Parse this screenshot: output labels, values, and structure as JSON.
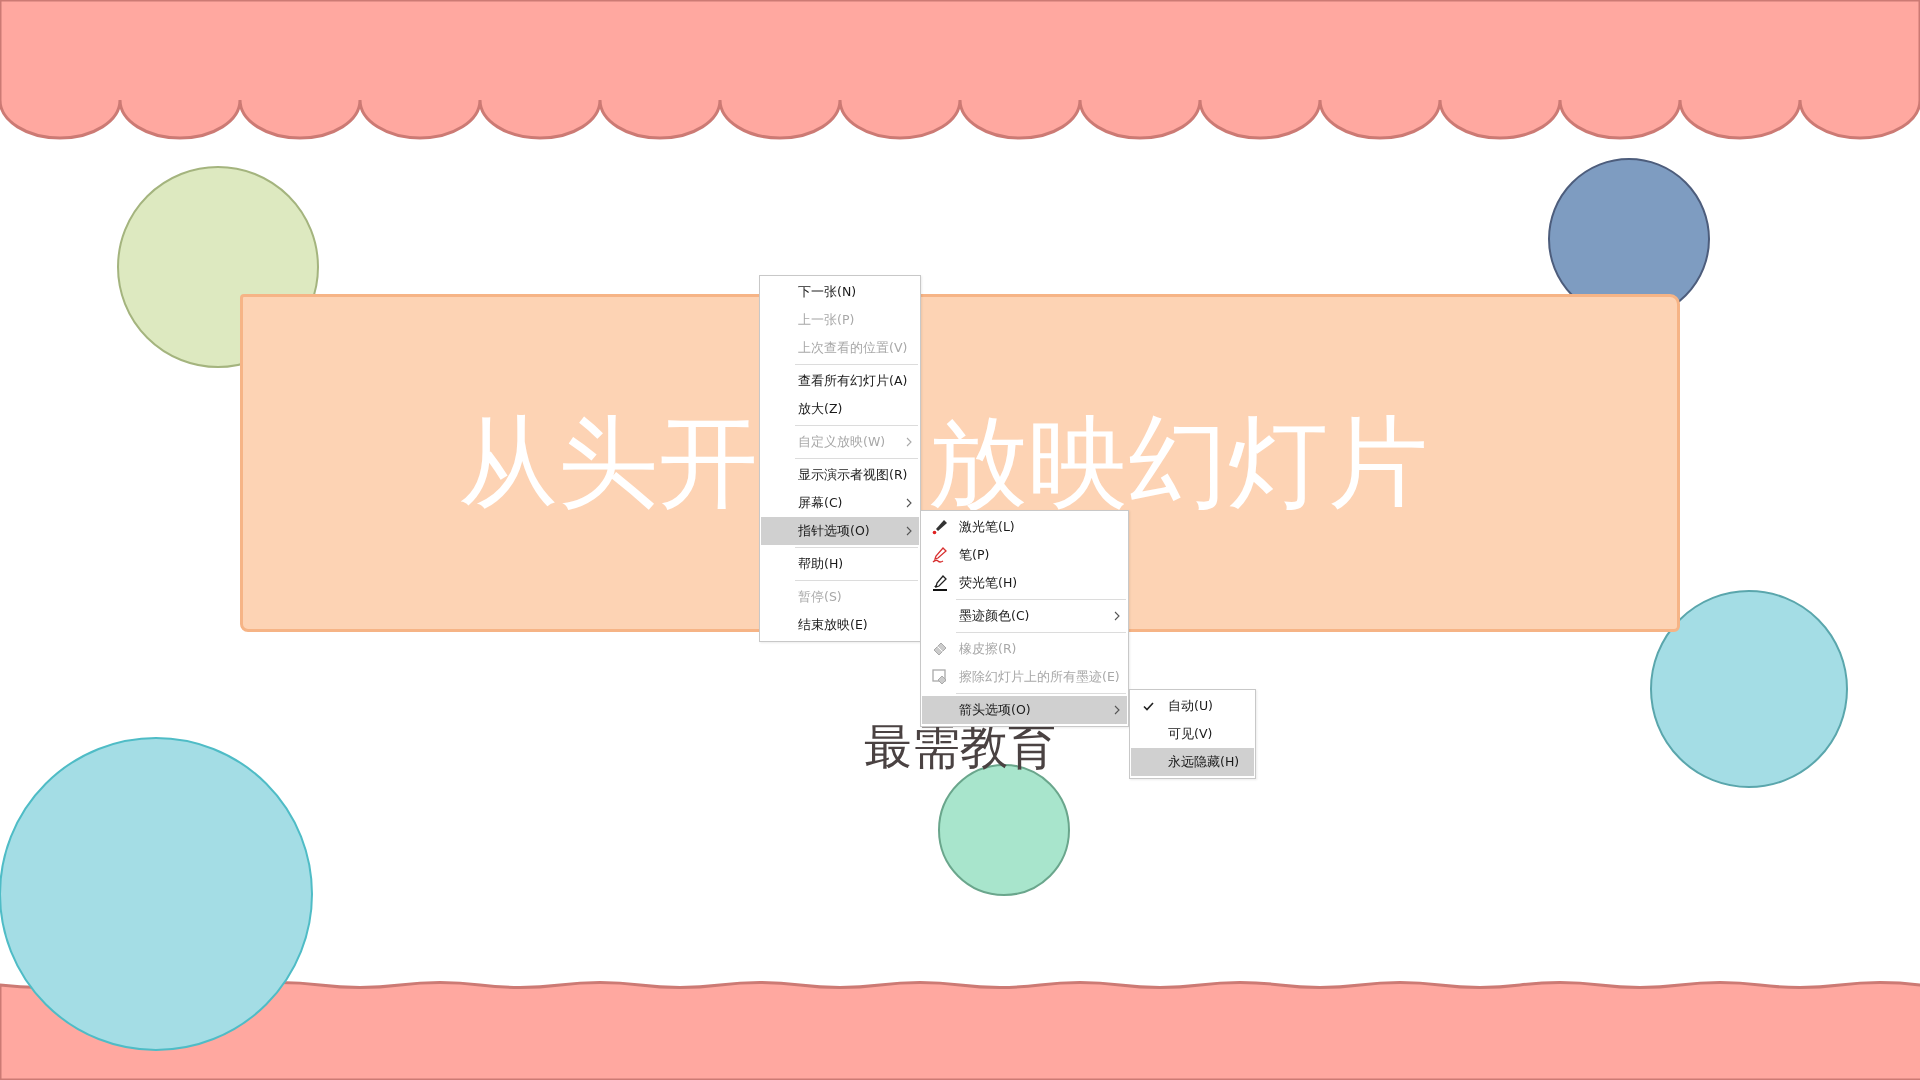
{
  "slide": {
    "title_fragments": [
      "从头开",
      "放映幻灯片"
    ],
    "subtitle": "最需教育"
  },
  "context_menu": [
    {
      "kind": "item",
      "label": "下一张(N)",
      "disabled": false,
      "selected": false,
      "submenu": false
    },
    {
      "kind": "item",
      "label": "上一张(P)",
      "disabled": true,
      "selected": false,
      "submenu": false
    },
    {
      "kind": "item",
      "label": "上次查看的位置(V)",
      "disabled": true,
      "selected": false,
      "submenu": false
    },
    {
      "kind": "separator"
    },
    {
      "kind": "item",
      "label": "查看所有幻灯片(A)",
      "disabled": false,
      "selected": false,
      "submenu": false
    },
    {
      "kind": "item",
      "label": "放大(Z)",
      "disabled": false,
      "selected": false,
      "submenu": false
    },
    {
      "kind": "separator"
    },
    {
      "kind": "item",
      "label": "自定义放映(W)",
      "disabled": true,
      "selected": false,
      "submenu": true
    },
    {
      "kind": "separator"
    },
    {
      "kind": "item",
      "label": "显示演示者视图(R)",
      "disabled": false,
      "selected": false,
      "submenu": false
    },
    {
      "kind": "item",
      "label": "屏幕(C)",
      "disabled": false,
      "selected": false,
      "submenu": true
    },
    {
      "kind": "item",
      "label": "指针选项(O)",
      "disabled": false,
      "selected": true,
      "submenu": true
    },
    {
      "kind": "separator"
    },
    {
      "kind": "item",
      "label": "帮助(H)",
      "disabled": false,
      "selected": false,
      "submenu": false
    },
    {
      "kind": "separator"
    },
    {
      "kind": "item",
      "label": "暂停(S)",
      "disabled": true,
      "selected": false,
      "submenu": false
    },
    {
      "kind": "item",
      "label": "结束放映(E)",
      "disabled": false,
      "selected": false,
      "submenu": false
    }
  ],
  "pointer_submenu": [
    {
      "kind": "item",
      "label": "激光笔(L)",
      "disabled": false,
      "selected": false,
      "submenu": false
    },
    {
      "kind": "item",
      "label": "笔(P)",
      "disabled": false,
      "selected": false,
      "submenu": false
    },
    {
      "kind": "item",
      "label": "荧光笔(H)",
      "disabled": false,
      "selected": false,
      "submenu": false
    },
    {
      "kind": "separator"
    },
    {
      "kind": "item",
      "label": "墨迹颜色(C)",
      "disabled": false,
      "selected": false,
      "submenu": true
    },
    {
      "kind": "separator"
    },
    {
      "kind": "item",
      "label": "橡皮擦(R)",
      "disabled": true,
      "selected": false,
      "submenu": false
    },
    {
      "kind": "item",
      "label": "擦除幻灯片上的所有墨迹(E)",
      "disabled": true,
      "selected": false,
      "submenu": false
    },
    {
      "kind": "separator"
    },
    {
      "kind": "item",
      "label": "箭头选项(O)",
      "disabled": false,
      "selected": true,
      "submenu": true
    }
  ],
  "arrow_submenu": [
    {
      "kind": "item",
      "label": "自动(U)",
      "disabled": false,
      "selected": false,
      "submenu": false,
      "checked": true
    },
    {
      "kind": "item",
      "label": "可见(V)",
      "disabled": false,
      "selected": false,
      "submenu": false,
      "checked": false
    },
    {
      "kind": "item",
      "label": "永远隐藏(H)",
      "disabled": false,
      "selected": true,
      "submenu": false,
      "checked": false
    }
  ]
}
